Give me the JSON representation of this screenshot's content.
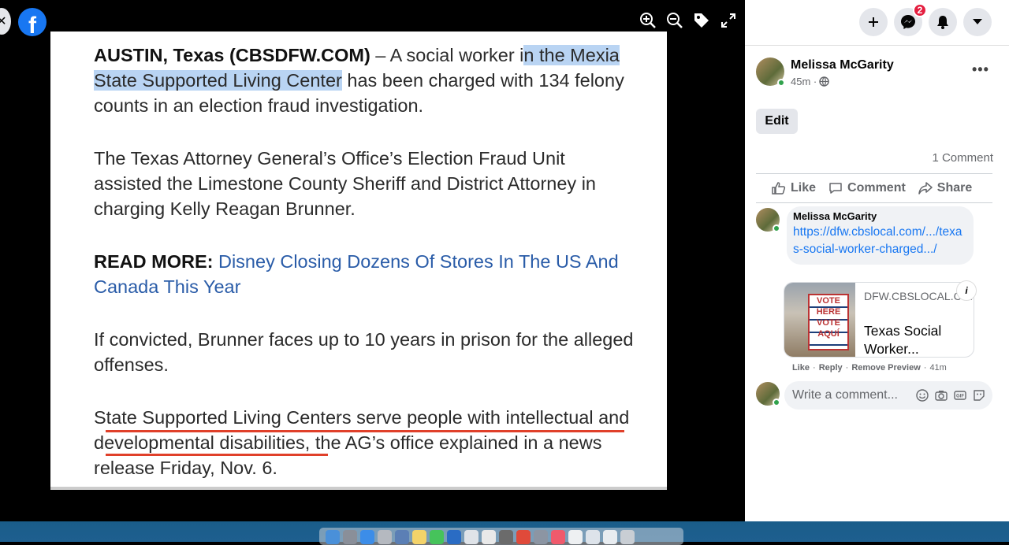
{
  "viewer": {
    "tools": [
      "zoom-in-icon",
      "zoom-out-icon",
      "tag-icon",
      "fullscreen-icon"
    ]
  },
  "article": {
    "p1_bold": "AUSTIN, Texas (CBSDFW.COM)",
    "p1_pre": " – A social worker i",
    "p1_highlight": "n the Mexia State Supported Living Center",
    "p1_post": " has been charged with 134 felony counts in an election fraud investigation.",
    "p2": "The Texas Attorney General’s Office’s Election Fraud Unit assisted the Limestone County Sheriff and District Attorney in charging Kelly Reagan Brunner.",
    "p3_bold": "READ MORE:",
    "p3_link": "Disney Closing Dozens Of Stores In The US And Canada This Year",
    "p4": "If convicted, Brunner faces up to 10 years in prison for the alleged offenses.",
    "p5": "State Supported Living Centers serve people with intellectual and developmental disabilities, the AG’s office explained in a news release Friday, Nov. 6."
  },
  "header": {
    "messenger_badge": "2"
  },
  "post": {
    "author": "Melissa McGarity",
    "time": "45m ·",
    "edit_label": "Edit",
    "comment_count": "1 Comment",
    "actions": {
      "like": "Like",
      "comment": "Comment",
      "share": "Share"
    }
  },
  "comment": {
    "author": "Melissa McGarity",
    "link": "https://dfw.cbslocal.com/.../texas-social-worker-charged.../",
    "preview_domain": "DFW.CBSLOCAL.COM",
    "preview_title": "Texas Social Worker...",
    "preview_sign": "VOTE HERE VOTE AQUÍ",
    "meta": {
      "like": "Like",
      "reply": "Reply",
      "remove": "Remove Preview",
      "time": "41m"
    }
  },
  "composer": {
    "placeholder": "Write a comment..."
  }
}
